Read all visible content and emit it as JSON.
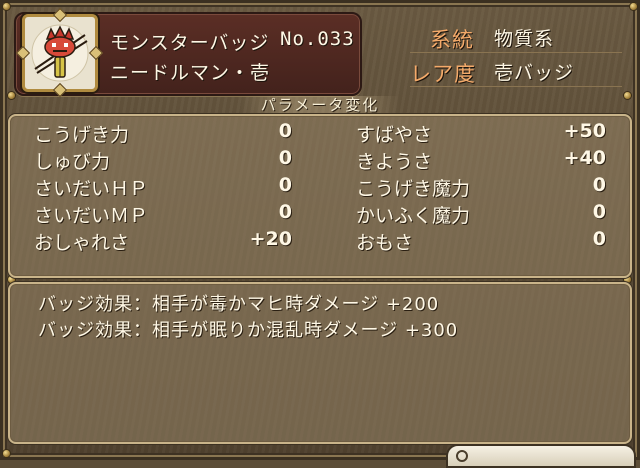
{
  "header": {
    "category": "モンスターバッジ",
    "number": "No.033",
    "name": "ニードルマン・壱"
  },
  "info": {
    "system_label": "系統",
    "system_value": "物質系",
    "rarity_label": "レア度",
    "rarity_value": "壱バッジ"
  },
  "section_title": "パラメータ変化",
  "stats_left": [
    {
      "label": "こうげき力",
      "value": "0"
    },
    {
      "label": "しゅび力",
      "value": "0"
    },
    {
      "label": "さいだいＨＰ",
      "value": "0"
    },
    {
      "label": "さいだいＭＰ",
      "value": "0"
    },
    {
      "label": "おしゃれさ",
      "value": "+20"
    }
  ],
  "stats_right": [
    {
      "label": "すばやさ",
      "value": "+50"
    },
    {
      "label": "きようさ",
      "value": "+40"
    },
    {
      "label": "こうげき魔力",
      "value": "0"
    },
    {
      "label": "かいふく魔力",
      "value": "0"
    },
    {
      "label": "おもさ",
      "value": "0"
    }
  ],
  "effects": [
    "バッジ効果：相手が毒かマヒ時ダメージ +200",
    "バッジ効果：相手が眠りか混乱時ダメージ +300"
  ],
  "colors": {
    "header_bg": "#4f2820",
    "info_key": "#f4aa6a",
    "text": "#fff8e6",
    "panel_border": "#c9b48a"
  }
}
